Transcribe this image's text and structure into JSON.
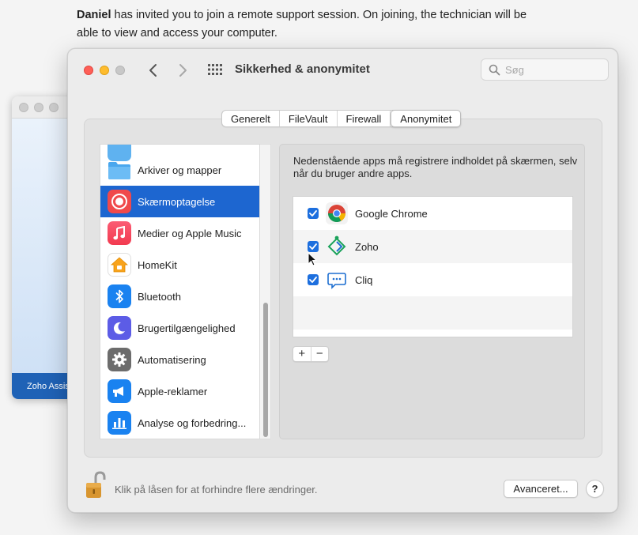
{
  "invite": {
    "host_name": "Daniel",
    "message": " has invited you to join a remote support session. On joining, the technician will be able to view and access your computer."
  },
  "background_window": {
    "footer_label": "Zoho Assis"
  },
  "window": {
    "title": "Sikkerhed & anonymitet",
    "search_placeholder": "Søg",
    "tabs": [
      {
        "label": "Generelt",
        "active": false
      },
      {
        "label": "FileVault",
        "active": false
      },
      {
        "label": "Firewall",
        "active": false
      },
      {
        "label": "Anonymitet",
        "active": true
      }
    ]
  },
  "sidebar": {
    "items": [
      {
        "label": "Arkiver og mapper",
        "icon": "folder-icon",
        "selected": false
      },
      {
        "label": "Skærmoptagelse",
        "icon": "screen-recording-icon",
        "selected": true
      },
      {
        "label": "Medier og Apple Music",
        "icon": "music-note-icon",
        "selected": false
      },
      {
        "label": "HomeKit",
        "icon": "home-icon",
        "selected": false
      },
      {
        "label": "Bluetooth",
        "icon": "bluetooth-icon",
        "selected": false
      },
      {
        "label": "Brugertilgængelighed",
        "icon": "moon-icon",
        "selected": false
      },
      {
        "label": "Automatisering",
        "icon": "gear-icon",
        "selected": false
      },
      {
        "label": "Apple-reklamer",
        "icon": "megaphone-icon",
        "selected": false
      },
      {
        "label": "Analyse og forbedring...",
        "icon": "analytics-chart-icon",
        "selected": false
      }
    ]
  },
  "panel": {
    "description": "Nedenstående apps må registrere indholdet på skærmen, selv når du bruger andre apps.",
    "apps": [
      {
        "label": "Google Chrome",
        "checked": true,
        "icon": "chrome-icon"
      },
      {
        "label": "Zoho",
        "checked": true,
        "icon": "zoho-icon"
      },
      {
        "label": "Cliq",
        "checked": true,
        "icon": "cliq-icon"
      }
    ],
    "add_label": "+",
    "remove_label": "−"
  },
  "footer": {
    "lock_text": "Klik på låsen for at forhindre flere ændringer.",
    "advanced_label": "Avanceret...",
    "help_label": "?"
  },
  "colors": {
    "selection": "#1d66d0",
    "checkbox": "#1d6fde",
    "close": "#fe5f57",
    "minimize": "#febc2e"
  }
}
